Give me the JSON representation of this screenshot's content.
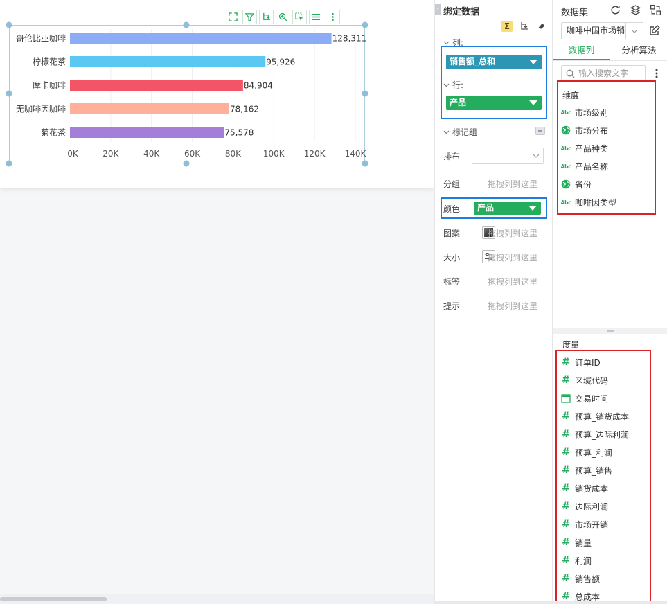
{
  "chart_data": {
    "type": "bar",
    "orientation": "horizontal",
    "categories": [
      "哥伦比亚咖啡",
      "柠檬花茶",
      "摩卡咖啡",
      "无咖啡因咖啡",
      "菊花茶"
    ],
    "series": [
      {
        "values": [
          128311,
          95926,
          84904,
          78162,
          75578
        ]
      }
    ],
    "colors": [
      "#8cacf6",
      "#5bc8f3",
      "#f35567",
      "#ffb09b",
      "#a47fd9"
    ],
    "data_labels": [
      "128,311",
      "95,926",
      "84,904",
      "78,162",
      "75,578"
    ],
    "x_ticks": [
      "0K",
      "20K",
      "40K",
      "60K",
      "80K",
      "100K",
      "120K",
      "140K"
    ],
    "xlim": [
      0,
      140000
    ],
    "xlabel": "",
    "ylabel": "",
    "grid": true
  },
  "chart_toolbar": [
    "fullscreen-icon",
    "filter-icon",
    "drill-icon",
    "zoom-icon",
    "select-icon",
    "list-icon",
    "more-icon"
  ],
  "bind": {
    "title": "绑定数据",
    "columns_label": "列:",
    "columns_pill": "销售额_总和",
    "rows_label": "行:",
    "rows_pill": "产品",
    "marks_title": "标记组",
    "marks": {
      "layout": "排布",
      "group": "分组",
      "group_hint": "拖拽列到这里",
      "color": "颜色",
      "color_pill": "产品",
      "pattern": "图案",
      "pattern_hint": "拖拽列到这里",
      "size": "大小",
      "size_hint": "拖拽列到这里",
      "label": "标签",
      "label_hint": "拖拽列到这里",
      "tooltip": "提示",
      "tooltip_hint": "拖拽列到这里"
    }
  },
  "dataset": {
    "title": "数据集",
    "selected": "咖啡中国市场销",
    "tabs": [
      "数据列",
      "分析算法"
    ],
    "search_placeholder": "输入搜索文字",
    "dimensions_title": "维度",
    "dimensions": [
      {
        "label": "市场级别",
        "icon": "abc-icon"
      },
      {
        "label": "市场分布",
        "icon": "globe-icon"
      },
      {
        "label": "产品种类",
        "icon": "abc-icon"
      },
      {
        "label": "产品名称",
        "icon": "abc-icon"
      },
      {
        "label": "省份",
        "icon": "globe-icon"
      },
      {
        "label": "咖啡因类型",
        "icon": "abc-icon"
      }
    ],
    "measures_title": "度量",
    "measures": [
      {
        "label": "订单ID",
        "icon": "hash-icon"
      },
      {
        "label": "区域代码",
        "icon": "hash-icon"
      },
      {
        "label": "交易时间",
        "icon": "calendar-icon"
      },
      {
        "label": "预算_销货成本",
        "icon": "hash-icon"
      },
      {
        "label": "预算_边际利润",
        "icon": "hash-icon"
      },
      {
        "label": "预算_利润",
        "icon": "hash-icon"
      },
      {
        "label": "预算_销售",
        "icon": "hash-icon"
      },
      {
        "label": "销货成本",
        "icon": "hash-icon"
      },
      {
        "label": "边际利润",
        "icon": "hash-icon"
      },
      {
        "label": "市场开销",
        "icon": "hash-icon"
      },
      {
        "label": "销量",
        "icon": "hash-icon"
      },
      {
        "label": "利润",
        "icon": "hash-icon"
      },
      {
        "label": "销售额",
        "icon": "hash-icon"
      },
      {
        "label": "总成本",
        "icon": "hash-icon"
      }
    ]
  }
}
